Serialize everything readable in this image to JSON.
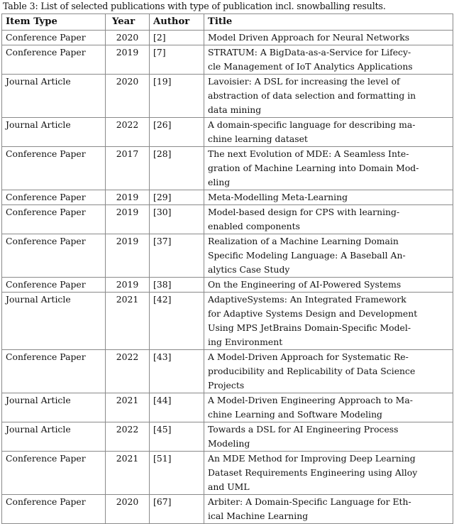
{
  "caption": {
    "label": "Table 3:",
    "text": "Table 3: List of selected publications with type of publication incl. snowballing results."
  },
  "table": {
    "columns": [
      {
        "key": "item_type",
        "label": "Item Type"
      },
      {
        "key": "year",
        "label": "Year"
      },
      {
        "key": "author",
        "label": "Author"
      },
      {
        "key": "title",
        "label": "Title"
      }
    ],
    "rows": [
      {
        "item_type": "Conference Paper",
        "year": "2020",
        "author": "[2]",
        "title": "Model Driven Approach for Neural Networks",
        "title_lines": [
          "Model Driven Approach for Neural Networks"
        ]
      },
      {
        "item_type": "Conference Paper",
        "year": "2019",
        "author": "[7]",
        "title": "STRATUM: A BigData-as-a-Service for Lifecycle Management of IoT Analytics Applications",
        "title_lines": [
          "STRATUM: A BigData-as-a-Service for Lifecy-",
          "cle Management of IoT Analytics Applications"
        ]
      },
      {
        "item_type": "Journal Article",
        "year": "2020",
        "author": "[19]",
        "title": "Lavoisier: A DSL for increasing the level of abstraction of data selection and formatting in data mining",
        "title_lines": [
          "Lavoisier: A DSL for increasing the level of",
          "abstraction of data selection and formatting in",
          "data mining"
        ]
      },
      {
        "item_type": "Journal Article",
        "year": "2022",
        "author": "[26]",
        "title": "A domain-specific language for describing machine learning dataset",
        "title_lines": [
          "A domain-specific language for describing ma-",
          "chine learning dataset"
        ]
      },
      {
        "item_type": "Conference Paper",
        "year": "2017",
        "author": "[28]",
        "title": "The next Evolution of MDE: A Seamless Integration of Machine Learning into Domain Modeling",
        "title_lines": [
          "The next Evolution of MDE: A Seamless Inte-",
          "gration of Machine Learning into Domain Mod-",
          "eling"
        ]
      },
      {
        "item_type": "Conference Paper",
        "year": "2019",
        "author": "[29]",
        "title": "Meta-Modelling Meta-Learning",
        "title_lines": [
          "Meta-Modelling Meta-Learning"
        ]
      },
      {
        "item_type": "Conference Paper",
        "year": "2019",
        "author": "[30]",
        "title": "Model-based design for CPS with learning-enabled components",
        "title_lines": [
          "Model-based design for CPS with learning-",
          "enabled components"
        ]
      },
      {
        "item_type": "Conference Paper",
        "year": "2019",
        "author": "[37]",
        "title": "Realization of a Machine Learning Domain Specific Modeling Language: A Baseball Analytics Case Study",
        "title_lines": [
          "Realization of a Machine Learning Domain",
          "Specific Modeling Language: A Baseball An-",
          "alytics Case Study"
        ]
      },
      {
        "item_type": "Conference Paper",
        "year": "2019",
        "author": "[38]",
        "title": "On the Engineering of AI-Powered Systems",
        "title_lines": [
          "On the Engineering of AI-Powered Systems"
        ]
      },
      {
        "item_type": "Journal Article",
        "year": "2021",
        "author": "[42]",
        "title": "AdaptiveSystems: An Integrated Framework for Adaptive Systems Design and Development Using MPS JetBrains Domain-Specific Modeling Environment",
        "title_lines": [
          "AdaptiveSystems: An Integrated Framework",
          "for Adaptive Systems Design and Development",
          "Using MPS JetBrains Domain-Specific Model-",
          "ing Environment"
        ]
      },
      {
        "item_type": "Conference Paper",
        "year": "2022",
        "author": "[43]",
        "title": "A Model-Driven Approach for Systematic Reproducibility and Replicability of Data Science Projects",
        "title_lines": [
          "A Model-Driven Approach for Systematic Re-",
          "producibility and Replicability of Data Science",
          "Projects"
        ]
      },
      {
        "item_type": "Journal Article",
        "year": "2021",
        "author": "[44]",
        "title": "A Model-Driven Engineering Approach to Machine Learning and Software Modeling",
        "title_lines": [
          "A Model-Driven Engineering Approach to Ma-",
          "chine Learning and Software Modeling"
        ]
      },
      {
        "item_type": "Journal Article",
        "year": "2022",
        "author": "[45]",
        "title": "Towards a DSL for AI Engineering Process Modeling",
        "title_lines": [
          "Towards a DSL for AI Engineering Process",
          "Modeling"
        ]
      },
      {
        "item_type": "Conference Paper",
        "year": "2021",
        "author": "[51]",
        "title": "An MDE Method for Improving Deep Learning Dataset Requirements Engineering using Alloy and UML",
        "title_lines": [
          "An MDE Method for Improving Deep Learning",
          "Dataset Requirements Engineering using Alloy",
          "and UML"
        ]
      },
      {
        "item_type": "Conference Paper",
        "year": "2020",
        "author": "[67]",
        "title": "Arbiter: A Domain-Specific Language for Ethical Machine Learning",
        "title_lines": [
          "Arbiter: A Domain-Specific Language for Eth-",
          "ical Machine Learning"
        ]
      }
    ]
  }
}
